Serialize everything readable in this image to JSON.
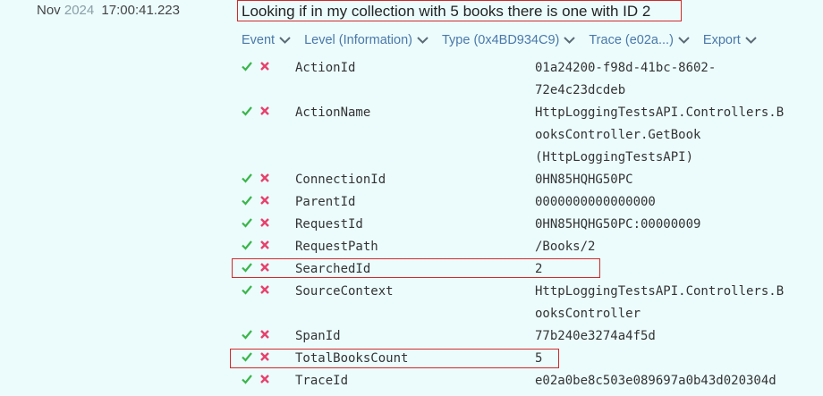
{
  "event": {
    "date": "Nov",
    "year": "2024",
    "time": "17:00:41.223",
    "message": "Looking if in my collection with 5 books there is one with ID 2"
  },
  "toolbar": {
    "items": [
      {
        "label": "Event"
      },
      {
        "label": "Level (Information)"
      },
      {
        "label": "Type (0x4BD934C9)"
      },
      {
        "label": "Trace (e02a...)"
      },
      {
        "label": "Export"
      }
    ]
  },
  "icons": {
    "include": "check-icon",
    "exclude": "x-icon",
    "include_color": "#3ab54a",
    "exclude_color": "#e8416c"
  },
  "properties": [
    {
      "key": "ActionId",
      "lines": [
        "01a24200-f98d-41bc-8602-",
        "72e4c23dcdeb"
      ]
    },
    {
      "key": "ActionName",
      "lines": [
        "HttpLoggingTestsAPI.Controllers.B",
        "ooksController.GetBook",
        "(HttpLoggingTestsAPI)"
      ]
    },
    {
      "key": "ConnectionId",
      "lines": [
        "0HN85HQHG50PC"
      ]
    },
    {
      "key": "ParentId",
      "lines": [
        "0000000000000000"
      ]
    },
    {
      "key": "RequestId",
      "lines": [
        "0HN85HQHG50PC:00000009"
      ]
    },
    {
      "key": "RequestPath",
      "lines": [
        "/Books/2"
      ]
    },
    {
      "key": "SearchedId",
      "lines": [
        "2"
      ]
    },
    {
      "key": "SourceContext",
      "lines": [
        "HttpLoggingTestsAPI.Controllers.B",
        "ooksController"
      ]
    },
    {
      "key": "SpanId",
      "lines": [
        "77b240e3274a4f5d"
      ]
    },
    {
      "key": "TotalBooksCount",
      "lines": [
        "5"
      ]
    },
    {
      "key": "TraceId",
      "lines": [
        "e02a0be8c503e089697a0b43d020304d"
      ]
    }
  ]
}
